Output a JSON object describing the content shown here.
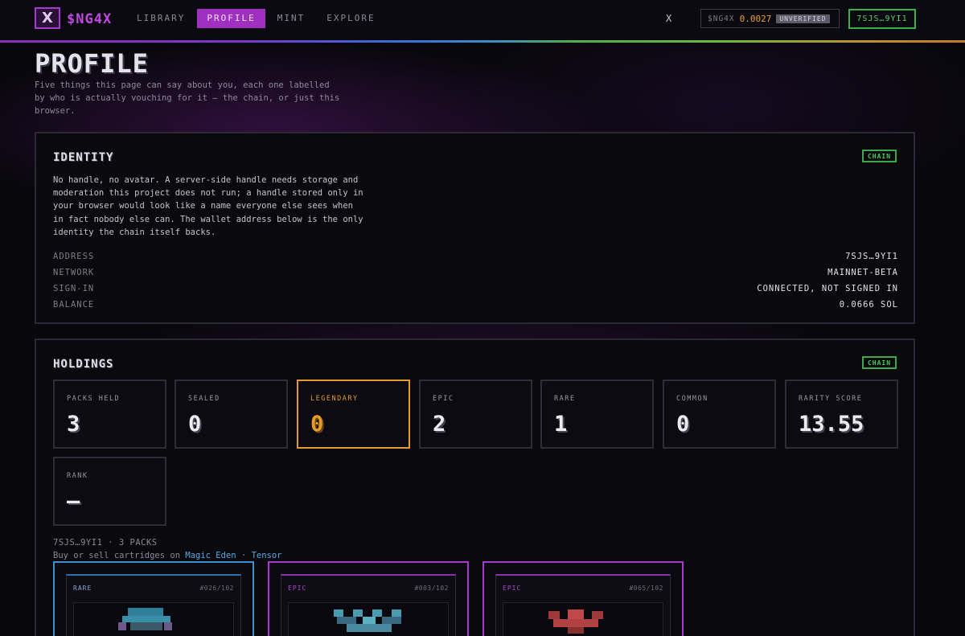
{
  "header": {
    "logo_text": "X",
    "brand": "$NG4X",
    "nav": [
      {
        "label": "LIBRARY",
        "active": false
      },
      {
        "label": "PROFILE",
        "active": true
      },
      {
        "label": "MINT",
        "active": false
      },
      {
        "label": "EXPLORE",
        "active": false
      }
    ],
    "close_label": "X",
    "token_ticker": "$NG4X",
    "token_price": "0.0027",
    "token_badge": "UNVERIFIED",
    "wallet_button": "7SJS…9YI1"
  },
  "page": {
    "title": "PROFILE",
    "description": "Five things this page can say about you, each one labelled by who is actually vouching for it — the chain, or just this browser."
  },
  "identity": {
    "title": "IDENTITY",
    "badge": "CHAIN",
    "description": "No handle, no avatar. A server-side handle needs storage and moderation this project does not run; a handle stored only in your browser would look like a name everyone else sees when in fact nobody else can. The wallet address below is the only identity the chain itself backs.",
    "rows": [
      {
        "key": "ADDRESS",
        "value": "7SJS…9YI1"
      },
      {
        "key": "NETWORK",
        "value": "MAINNET-BETA"
      },
      {
        "key": "SIGN-IN",
        "value": "CONNECTED, NOT SIGNED IN"
      },
      {
        "key": "BALANCE",
        "value": "0.0666 SOL"
      }
    ]
  },
  "holdings": {
    "title": "HOLDINGS",
    "badge": "CHAIN",
    "stats": [
      {
        "label": "PACKS HELD",
        "value": "3"
      },
      {
        "label": "SEALED",
        "value": "0"
      },
      {
        "label": "LEGENDARY",
        "value": "0"
      },
      {
        "label": "EPIC",
        "value": "2"
      },
      {
        "label": "RARE",
        "value": "1"
      },
      {
        "label": "COMMON",
        "value": "0"
      },
      {
        "label": "RARITY SCORE",
        "value": "13.55"
      },
      {
        "label": "RANK",
        "value": "—"
      }
    ],
    "owner_line": "7SJS…9YI1 · 3 PACKS",
    "market_prefix": "Buy or sell cartridges on ",
    "market_link_1": "Magic Eden",
    "market_sep": " · ",
    "market_link_2": "Tensor",
    "cartridges": [
      {
        "tier": "RARE",
        "number": "#026/102"
      },
      {
        "tier": "EPIC",
        "number": "#003/102"
      },
      {
        "tier": "EPIC",
        "number": "#065/102"
      }
    ]
  },
  "colors": {
    "accent_purple": "#a030c0",
    "chain_green": "#3caa48",
    "legendary_orange": "#e49a2c",
    "rare_blue": "#3a90d0",
    "epic_purple": "#a838d0"
  }
}
